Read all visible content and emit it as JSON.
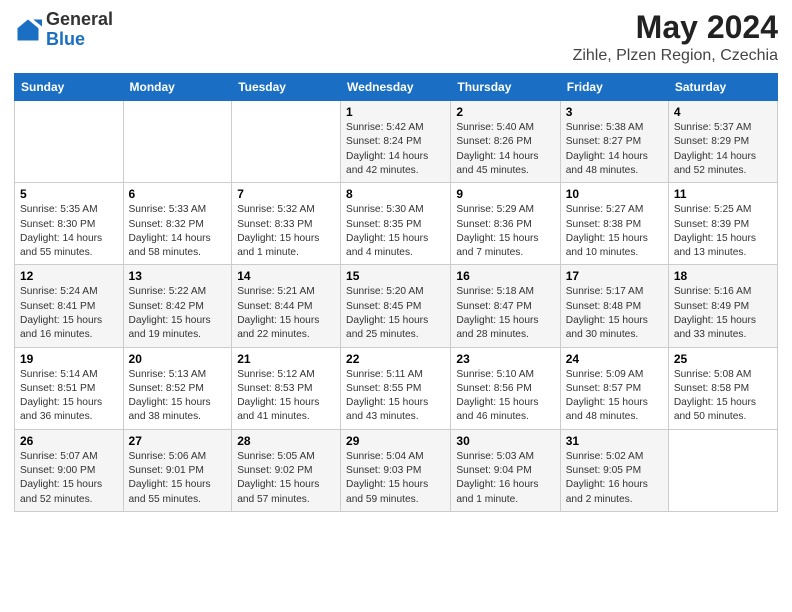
{
  "header": {
    "logo_general": "General",
    "logo_blue": "Blue",
    "month_year": "May 2024",
    "location": "Zihle, Plzen Region, Czechia"
  },
  "weekdays": [
    "Sunday",
    "Monday",
    "Tuesday",
    "Wednesday",
    "Thursday",
    "Friday",
    "Saturday"
  ],
  "weeks": [
    [
      {
        "day": "",
        "info": ""
      },
      {
        "day": "",
        "info": ""
      },
      {
        "day": "",
        "info": ""
      },
      {
        "day": "1",
        "info": "Sunrise: 5:42 AM\nSunset: 8:24 PM\nDaylight: 14 hours\nand 42 minutes."
      },
      {
        "day": "2",
        "info": "Sunrise: 5:40 AM\nSunset: 8:26 PM\nDaylight: 14 hours\nand 45 minutes."
      },
      {
        "day": "3",
        "info": "Sunrise: 5:38 AM\nSunset: 8:27 PM\nDaylight: 14 hours\nand 48 minutes."
      },
      {
        "day": "4",
        "info": "Sunrise: 5:37 AM\nSunset: 8:29 PM\nDaylight: 14 hours\nand 52 minutes."
      }
    ],
    [
      {
        "day": "5",
        "info": "Sunrise: 5:35 AM\nSunset: 8:30 PM\nDaylight: 14 hours\nand 55 minutes."
      },
      {
        "day": "6",
        "info": "Sunrise: 5:33 AM\nSunset: 8:32 PM\nDaylight: 14 hours\nand 58 minutes."
      },
      {
        "day": "7",
        "info": "Sunrise: 5:32 AM\nSunset: 8:33 PM\nDaylight: 15 hours\nand 1 minute."
      },
      {
        "day": "8",
        "info": "Sunrise: 5:30 AM\nSunset: 8:35 PM\nDaylight: 15 hours\nand 4 minutes."
      },
      {
        "day": "9",
        "info": "Sunrise: 5:29 AM\nSunset: 8:36 PM\nDaylight: 15 hours\nand 7 minutes."
      },
      {
        "day": "10",
        "info": "Sunrise: 5:27 AM\nSunset: 8:38 PM\nDaylight: 15 hours\nand 10 minutes."
      },
      {
        "day": "11",
        "info": "Sunrise: 5:25 AM\nSunset: 8:39 PM\nDaylight: 15 hours\nand 13 minutes."
      }
    ],
    [
      {
        "day": "12",
        "info": "Sunrise: 5:24 AM\nSunset: 8:41 PM\nDaylight: 15 hours\nand 16 minutes."
      },
      {
        "day": "13",
        "info": "Sunrise: 5:22 AM\nSunset: 8:42 PM\nDaylight: 15 hours\nand 19 minutes."
      },
      {
        "day": "14",
        "info": "Sunrise: 5:21 AM\nSunset: 8:44 PM\nDaylight: 15 hours\nand 22 minutes."
      },
      {
        "day": "15",
        "info": "Sunrise: 5:20 AM\nSunset: 8:45 PM\nDaylight: 15 hours\nand 25 minutes."
      },
      {
        "day": "16",
        "info": "Sunrise: 5:18 AM\nSunset: 8:47 PM\nDaylight: 15 hours\nand 28 minutes."
      },
      {
        "day": "17",
        "info": "Sunrise: 5:17 AM\nSunset: 8:48 PM\nDaylight: 15 hours\nand 30 minutes."
      },
      {
        "day": "18",
        "info": "Sunrise: 5:16 AM\nSunset: 8:49 PM\nDaylight: 15 hours\nand 33 minutes."
      }
    ],
    [
      {
        "day": "19",
        "info": "Sunrise: 5:14 AM\nSunset: 8:51 PM\nDaylight: 15 hours\nand 36 minutes."
      },
      {
        "day": "20",
        "info": "Sunrise: 5:13 AM\nSunset: 8:52 PM\nDaylight: 15 hours\nand 38 minutes."
      },
      {
        "day": "21",
        "info": "Sunrise: 5:12 AM\nSunset: 8:53 PM\nDaylight: 15 hours\nand 41 minutes."
      },
      {
        "day": "22",
        "info": "Sunrise: 5:11 AM\nSunset: 8:55 PM\nDaylight: 15 hours\nand 43 minutes."
      },
      {
        "day": "23",
        "info": "Sunrise: 5:10 AM\nSunset: 8:56 PM\nDaylight: 15 hours\nand 46 minutes."
      },
      {
        "day": "24",
        "info": "Sunrise: 5:09 AM\nSunset: 8:57 PM\nDaylight: 15 hours\nand 48 minutes."
      },
      {
        "day": "25",
        "info": "Sunrise: 5:08 AM\nSunset: 8:58 PM\nDaylight: 15 hours\nand 50 minutes."
      }
    ],
    [
      {
        "day": "26",
        "info": "Sunrise: 5:07 AM\nSunset: 9:00 PM\nDaylight: 15 hours\nand 52 minutes."
      },
      {
        "day": "27",
        "info": "Sunrise: 5:06 AM\nSunset: 9:01 PM\nDaylight: 15 hours\nand 55 minutes."
      },
      {
        "day": "28",
        "info": "Sunrise: 5:05 AM\nSunset: 9:02 PM\nDaylight: 15 hours\nand 57 minutes."
      },
      {
        "day": "29",
        "info": "Sunrise: 5:04 AM\nSunset: 9:03 PM\nDaylight: 15 hours\nand 59 minutes."
      },
      {
        "day": "30",
        "info": "Sunrise: 5:03 AM\nSunset: 9:04 PM\nDaylight: 16 hours\nand 1 minute."
      },
      {
        "day": "31",
        "info": "Sunrise: 5:02 AM\nSunset: 9:05 PM\nDaylight: 16 hours\nand 2 minutes."
      },
      {
        "day": "",
        "info": ""
      }
    ]
  ]
}
